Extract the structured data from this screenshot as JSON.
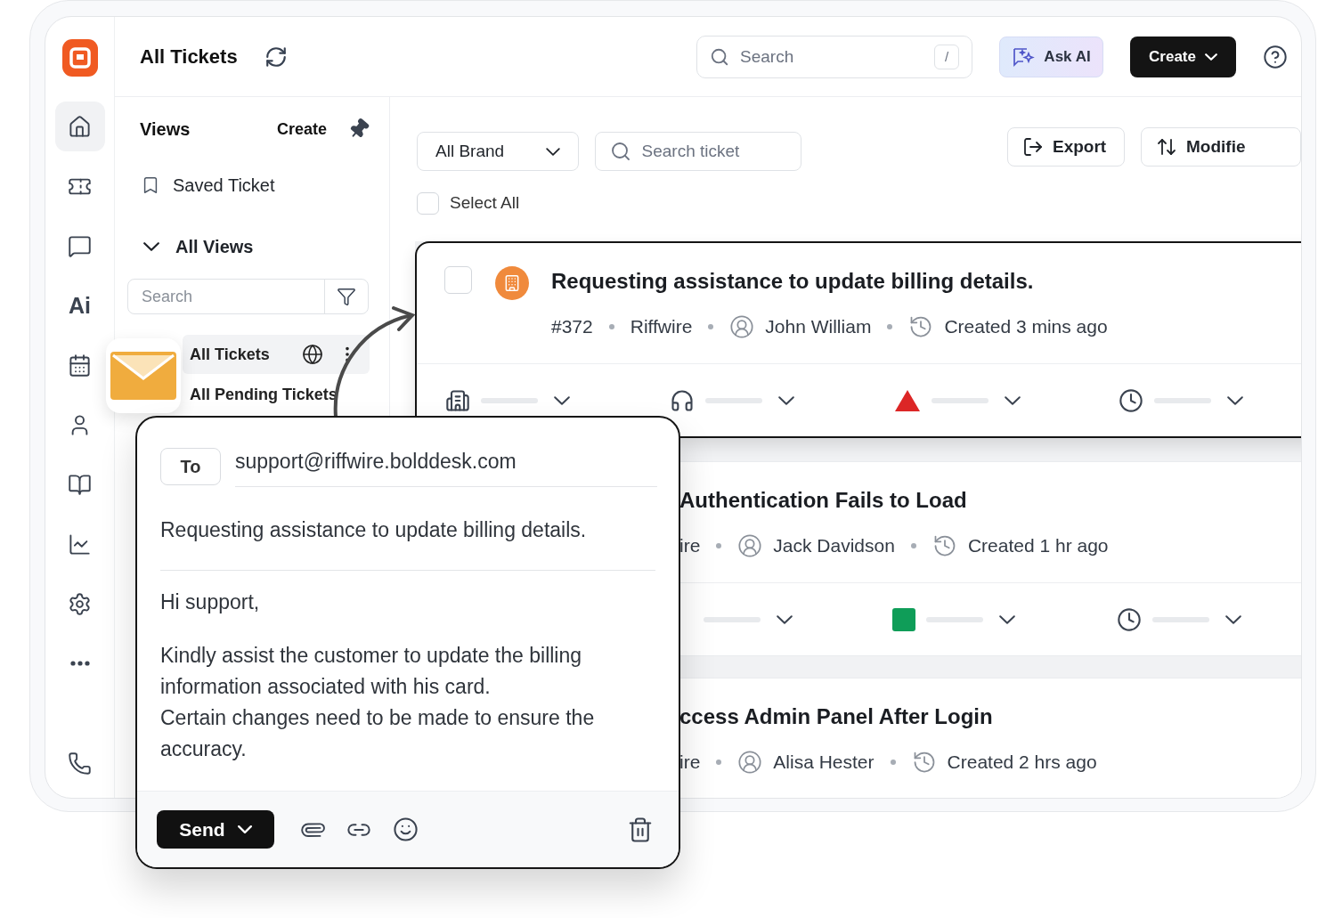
{
  "nav_rail": {
    "items": [
      {
        "selected": true
      },
      {
        "selected": false
      },
      {
        "selected": false
      },
      {
        "label": "Ai",
        "selected": false
      },
      {
        "selected": false
      },
      {
        "selected": false
      },
      {
        "selected": false
      },
      {
        "selected": false
      },
      {
        "selected": false
      },
      {
        "selected": false
      },
      {
        "selected": false
      }
    ]
  },
  "header": {
    "title": "All Tickets",
    "search": {
      "placeholder": "Search",
      "shortcut": "/"
    },
    "ask_ai": "Ask AI",
    "create": "Create"
  },
  "views_panel": {
    "title": "Views",
    "create": "Create",
    "saved": "Saved Ticket",
    "group": {
      "label": "All Views",
      "expanded": true
    },
    "search": {
      "placeholder": "Search"
    },
    "items": [
      {
        "label": "All Tickets",
        "selected": true
      },
      {
        "label": "All Pending Tickets",
        "selected": false
      }
    ]
  },
  "toolbar": {
    "brand": "All Brand",
    "search": {
      "placeholder": "Search ticket"
    },
    "export": "Export",
    "sort": "Modifie",
    "select_all": {
      "label": "Select All",
      "checked": false
    }
  },
  "tickets": [
    {
      "title": "Requesting assistance to update billing details.",
      "selected": true,
      "checked": false,
      "meta": [
        {
          "kind": "text",
          "text": "#372"
        },
        {
          "kind": "text",
          "text": "Riffwire"
        },
        {
          "kind": "person",
          "text": "John William"
        },
        {
          "kind": "time",
          "text": "Created 3 mins ago"
        }
      ],
      "fields": [
        {
          "kind": "brand"
        },
        {
          "kind": "agent"
        },
        {
          "kind": "urgent",
          "color": "#dc2626"
        },
        {
          "kind": "due"
        }
      ]
    },
    {
      "title": "Authentication Fails to Load",
      "selected": false,
      "meta": [
        {
          "kind": "text",
          "text": "ire"
        },
        {
          "kind": "person",
          "text": "Jack Davidson"
        },
        {
          "kind": "time",
          "text": "Created 1 hr ago"
        }
      ],
      "fields": [
        {
          "kind": "agent"
        },
        {
          "kind": "low",
          "color": "#0f9d58"
        },
        {
          "kind": "due"
        }
      ]
    },
    {
      "title": "ccess Admin Panel After Login",
      "selected": false,
      "meta": [
        {
          "kind": "text",
          "text": "ire"
        },
        {
          "kind": "person",
          "text": "Alisa Hester"
        },
        {
          "kind": "time",
          "text": "Created 2 hrs ago"
        }
      ]
    }
  ],
  "compose": {
    "to_label": "To",
    "to": "support@riffwire.bolddesk.com",
    "subject": "Requesting assistance to update billing details.",
    "body": [
      "Hi support,",
      "Kindly assist the customer to update the billing information associated with his card.",
      "Certain changes need to be made to ensure the accuracy."
    ],
    "send": "Send"
  }
}
